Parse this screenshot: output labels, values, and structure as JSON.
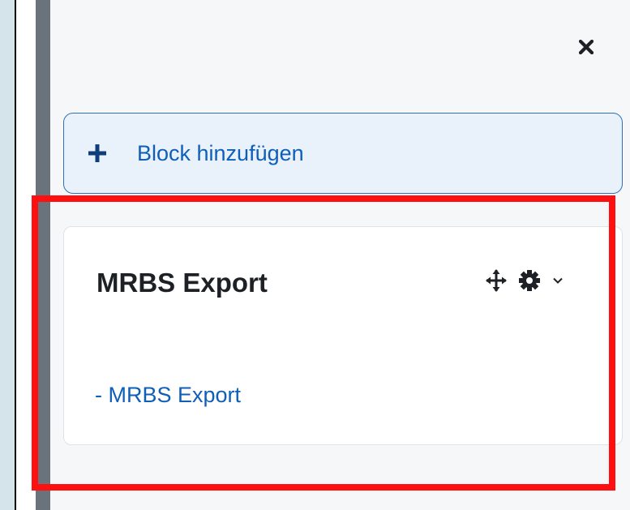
{
  "drawer": {
    "close_icon": "close-icon",
    "add_block": {
      "label": "Block hinzufügen",
      "icon": "plus-icon"
    },
    "block": {
      "title": "MRBS Export",
      "link_text": "- MRBS Export",
      "icons": [
        "move-icon",
        "gear-icon",
        "chevron-down-icon"
      ]
    }
  },
  "colors": {
    "link": "#0f5fb8",
    "add_block_background": "#e9f2fb",
    "add_block_border": "#2f6fb5",
    "drawer_background": "#f6f7f9",
    "drawer_bar": "#6a737b",
    "highlight": "#ff1010"
  }
}
